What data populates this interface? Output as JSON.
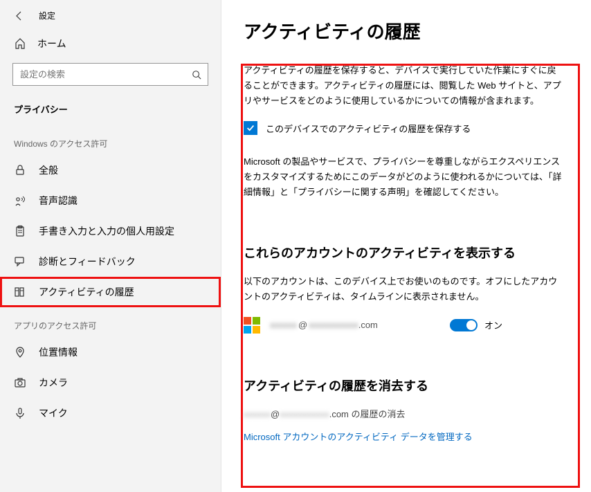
{
  "header": {
    "title": "設定"
  },
  "home": {
    "label": "ホーム"
  },
  "search": {
    "placeholder": "設定の検索"
  },
  "section": {
    "label": "プライバシー"
  },
  "groups": {
    "windows": "Windows のアクセス許可",
    "apps": "アプリのアクセス許可"
  },
  "nav": {
    "general": "全般",
    "speech": "音声認識",
    "inking": "手書き入力と入力の個人用設定",
    "diagnostics": "診断とフィードバック",
    "activity": "アクティビティの履歴",
    "location": "位置情報",
    "camera": "カメラ",
    "mic": "マイク"
  },
  "main": {
    "title": "アクティビティの履歴",
    "intro": "アクティビティの履歴を保存すると、デバイスで実行していた作業にすぐに戻ることができます。アクティビティの履歴には、閲覧した Web サイトと、アプリやサービスをどのように使用しているかについての情報が含まれます。",
    "checkbox_label": "このデバイスでのアクティビティの履歴を保存する",
    "para2": "Microsoft の製品やサービスで、プライバシーを尊重しながらエクスペリエンスをカスタマイズするためにこのデータがどのように使われるかについては、「詳細情報」と「プライバシーに関する声明」を確認してください。",
    "accounts_heading": "これらのアカウントのアクティビティを表示する",
    "accounts_desc": "以下のアカウントは、このデバイス上でお使いのものです。オフにしたアカウントのアクティビティは、タイムラインに表示されません。",
    "account_masked_user": "xxxxxx",
    "account_at": "@",
    "account_masked_domain": "xxxxxxxxxxx",
    "account_tld": ".com",
    "toggle_label": "オン",
    "clear_heading": "アクティビティの履歴を消去する",
    "clear_suffix": ".com の履歴の消去",
    "link": "Microsoft アカウントのアクティビティ データを管理する"
  }
}
